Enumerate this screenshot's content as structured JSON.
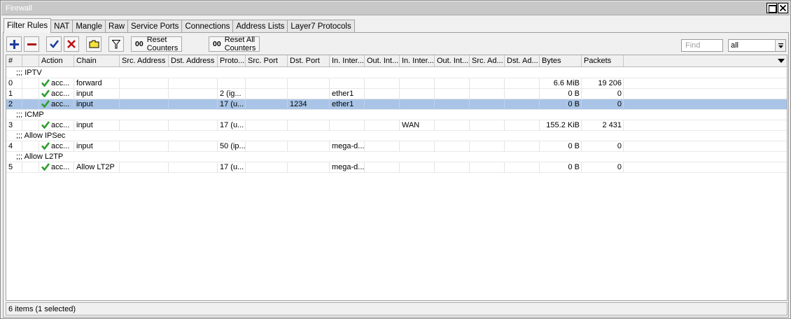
{
  "window": {
    "title": "Firewall"
  },
  "tabs": [
    {
      "label": "Filter Rules",
      "active": true
    },
    {
      "label": "NAT"
    },
    {
      "label": "Mangle"
    },
    {
      "label": "Raw"
    },
    {
      "label": "Service Ports"
    },
    {
      "label": "Connections"
    },
    {
      "label": "Address Lists"
    },
    {
      "label": "Layer7 Protocols"
    }
  ],
  "toolbar": {
    "add_icon": "plus-icon",
    "remove_icon": "minus-icon",
    "enable_icon": "checkmark-icon",
    "disable_icon": "cross-icon",
    "comment_icon": "comment-icon",
    "filter_icon": "funnel-icon",
    "reset_counters_prefix": "00",
    "reset_counters_label": "Reset Counters",
    "reset_all_prefix": "00",
    "reset_all_label": "Reset All Counters"
  },
  "search": {
    "placeholder": "Find",
    "filter_value": "all"
  },
  "columns": [
    "#",
    "",
    "Action",
    "Chain",
    "Src. Address",
    "Dst. Address",
    "Proto...",
    "Src. Port",
    "Dst. Port",
    "In. Inter...",
    "Out. Int...",
    "In. Inter...",
    "Out. Int...",
    "Src. Ad...",
    "Dst. Ad...",
    "Bytes",
    "Packets"
  ],
  "rows": [
    {
      "type": "comment",
      "text": ";;; IPTV"
    },
    {
      "type": "rule",
      "id": "0",
      "action": "acc...",
      "chain": "forward",
      "src_address": "",
      "dst_address": "",
      "protocol": "",
      "src_port": "",
      "dst_port": "",
      "in_interface": "",
      "out_interface": "",
      "in_interface_list": "",
      "out_interface_list": "",
      "src_address_list": "",
      "dst_address_list": "",
      "bytes": "6.6 MiB",
      "packets": "19 206"
    },
    {
      "type": "rule",
      "id": "1",
      "action": "acc...",
      "chain": "input",
      "src_address": "",
      "dst_address": "",
      "protocol": "2 (ig...",
      "src_port": "",
      "dst_port": "",
      "in_interface": "ether1",
      "out_interface": "",
      "in_interface_list": "",
      "out_interface_list": "",
      "src_address_list": "",
      "dst_address_list": "",
      "bytes": "0 B",
      "packets": "0"
    },
    {
      "type": "rule",
      "id": "2",
      "selected": true,
      "action": "acc...",
      "chain": "input",
      "src_address": "",
      "dst_address": "",
      "protocol": "17 (u...",
      "src_port": "",
      "dst_port": "1234",
      "in_interface": "ether1",
      "out_interface": "",
      "in_interface_list": "",
      "out_interface_list": "",
      "src_address_list": "",
      "dst_address_list": "",
      "bytes": "0 B",
      "packets": "0"
    },
    {
      "type": "comment",
      "text": ";;; ICMP"
    },
    {
      "type": "rule",
      "id": "3",
      "action": "acc...",
      "chain": "input",
      "src_address": "",
      "dst_address": "",
      "protocol": "17 (u...",
      "src_port": "",
      "dst_port": "",
      "in_interface": "",
      "out_interface": "",
      "in_interface_list": "WAN",
      "out_interface_list": "",
      "src_address_list": "",
      "dst_address_list": "",
      "bytes": "155.2 KiB",
      "packets": "2 431"
    },
    {
      "type": "comment",
      "text": ";;; Allow IPSec"
    },
    {
      "type": "rule",
      "id": "4",
      "action": "acc...",
      "chain": "input",
      "src_address": "",
      "dst_address": "",
      "protocol": "50 (ip...",
      "src_port": "",
      "dst_port": "",
      "in_interface": "mega-d...",
      "out_interface": "",
      "in_interface_list": "",
      "out_interface_list": "",
      "src_address_list": "",
      "dst_address_list": "",
      "bytes": "0 B",
      "packets": "0"
    },
    {
      "type": "comment",
      "text": ";;; Allow L2TP"
    },
    {
      "type": "rule",
      "id": "5",
      "action": "acc...",
      "chain": "Allow LT2P",
      "src_address": "",
      "dst_address": "",
      "protocol": "17 (u...",
      "src_port": "",
      "dst_port": "",
      "in_interface": "mega-d...",
      "out_interface": "",
      "in_interface_list": "",
      "out_interface_list": "",
      "src_address_list": "",
      "dst_address_list": "",
      "bytes": "0 B",
      "packets": "0"
    }
  ],
  "status": {
    "text": "6 items (1 selected)"
  },
  "colors": {
    "selected_row": "#a9c4e6",
    "accept_check": "#2e9e2e",
    "add_blue": "#1c3f9e",
    "remove_red": "#b01010"
  }
}
